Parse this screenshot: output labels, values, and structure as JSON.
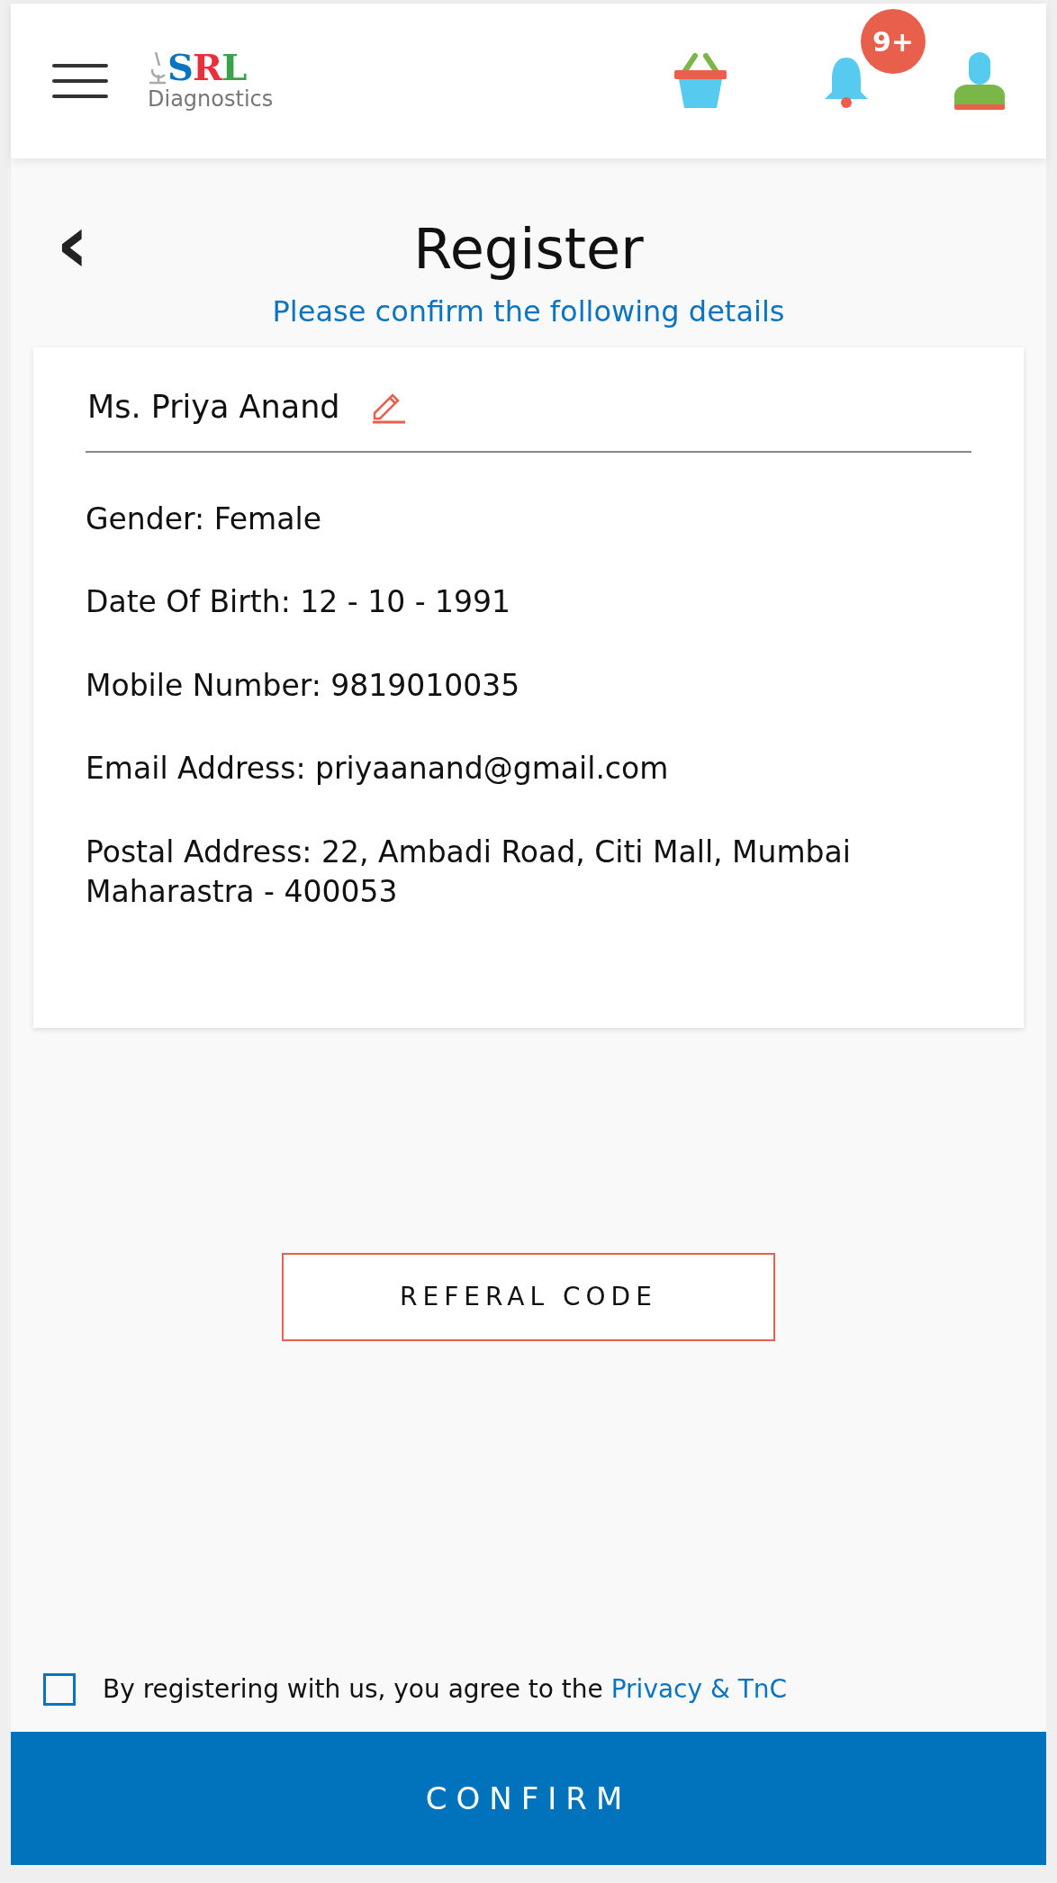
{
  "header": {
    "logo": {
      "letters": [
        {
          "text": "S",
          "color": "#0a74c0"
        },
        {
          "text": "R",
          "color": "#e8303d"
        },
        {
          "text": "L",
          "color": "#3aa34a"
        }
      ],
      "subtitle": "Diagnostics"
    },
    "notification_badge": "9+"
  },
  "page": {
    "back": "‹",
    "title": "Register",
    "subtitle": "Please confirm the following details"
  },
  "details": {
    "name": "Ms. Priya Anand",
    "fields": [
      {
        "label": "Gender:",
        "value": "Female"
      },
      {
        "label": "Date Of Birth:",
        "value": "12 - 10 - 1991"
      },
      {
        "label": "Mobile Number:",
        "value": "9819010035"
      },
      {
        "label": "Email Address:",
        "value": "priyaanand@gmail.com"
      },
      {
        "label": "Postal Address:",
        "value": "22, Ambadi Road, Citi Mall, Mumbai Maharastra - 400053"
      }
    ]
  },
  "referral_button": "REFERAL CODE",
  "agreement": {
    "checked": false,
    "text": "By registering with us, you agree to the",
    "link": "Privacy & TnC"
  },
  "confirm_button": "CONFIRM"
}
